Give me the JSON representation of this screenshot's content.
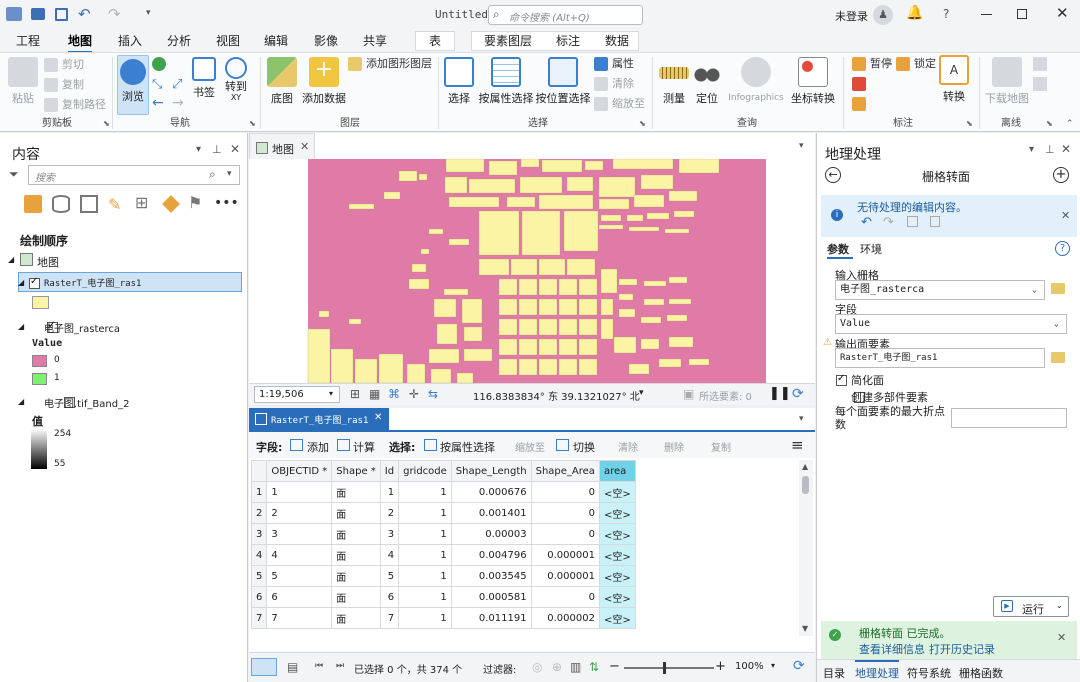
{
  "app": {
    "document_title": "Untitled",
    "command_search_placeholder": "命令搜索 (Alt+Q)",
    "user": "未登录",
    "help": "?"
  },
  "ribbon_tabs": [
    "工程",
    "地图",
    "插入",
    "分析",
    "视图",
    "编辑",
    "影像",
    "共享",
    "表",
    "要素图层",
    "标注",
    "数据"
  ],
  "ribbon": {
    "clipboard": {
      "paste": "粘贴",
      "cut": "剪切",
      "copy": "复制",
      "copy_path": "复制路径",
      "group": "剪贴板"
    },
    "navigate": {
      "explore": "浏览",
      "bookmarks": "书签",
      "goto": "转到\nXY",
      "group": "导航"
    },
    "layer": {
      "basemap": "底图",
      "add_data": "添加数据",
      "add_graphics": "添加图形图层",
      "group": "图层"
    },
    "selection": {
      "select": "选择",
      "by_attr": "按属性选择",
      "by_loc": "按位置选择",
      "attributes": "属性",
      "clear": "清除",
      "zoom_to": "缩放至",
      "group": "选择"
    },
    "inquiry": {
      "measure": "测量",
      "locate": "定位",
      "infographics": "Infographics",
      "convert_coords": "坐标转换",
      "group": "查询"
    },
    "labeling": {
      "pause": "暂停",
      "lock": "锁定",
      "convert": "转换",
      "group": "标注"
    },
    "offline": {
      "download_map": "下载地图",
      "group": "离线"
    }
  },
  "contents": {
    "title": "内容",
    "search_placeholder": "搜索",
    "drawing_order": "绘制顺序",
    "map_node": "地图",
    "layer1": "RasterT_电子图_ras1",
    "layer2": "电子图_rasterca",
    "layer2_value_label": "Value",
    "layer2_v0": "0",
    "layer2_v1": "1",
    "layer3": "电子图.tif_Band_2",
    "layer3_value_label": "值",
    "layer3_max": "254",
    "layer3_min": "55"
  },
  "map_view": {
    "tab": "地图",
    "scale": "1:19,506",
    "coords": "116.8383834° 东  39.1321027° 北",
    "selected_features": "所选要素: 0"
  },
  "attribute_table": {
    "tab": "RasterT_电子图_ras1",
    "toolbar": {
      "field_label": "字段:",
      "add": "添加",
      "calculate": "计算",
      "selection_label": "选择:",
      "select_by_attr": "按属性选择",
      "zoom_to": "缩放至",
      "switch": "切换",
      "clear": "清除",
      "delete": "删除",
      "copy": "复制"
    },
    "columns": [
      "OBJECTID *",
      "Shape *",
      "Id",
      "gridcode",
      "Shape_Length",
      "Shape_Area",
      "area"
    ],
    "rows": [
      {
        "n": "1",
        "oid": "1",
        "shape": "面",
        "id": "1",
        "gridcode": "1",
        "len": "0.000676",
        "area_s": "0",
        "area": "<空>"
      },
      {
        "n": "2",
        "oid": "2",
        "shape": "面",
        "id": "2",
        "gridcode": "1",
        "len": "0.001401",
        "area_s": "0",
        "area": "<空>"
      },
      {
        "n": "3",
        "oid": "3",
        "shape": "面",
        "id": "3",
        "gridcode": "1",
        "len": "0.00003",
        "area_s": "0",
        "area": "<空>"
      },
      {
        "n": "4",
        "oid": "4",
        "shape": "面",
        "id": "4",
        "gridcode": "1",
        "len": "0.004796",
        "area_s": "0.000001",
        "area": "<空>"
      },
      {
        "n": "5",
        "oid": "5",
        "shape": "面",
        "id": "5",
        "gridcode": "1",
        "len": "0.003545",
        "area_s": "0.000001",
        "area": "<空>"
      },
      {
        "n": "6",
        "oid": "6",
        "shape": "面",
        "id": "6",
        "gridcode": "1",
        "len": "0.000581",
        "area_s": "0",
        "area": "<空>"
      },
      {
        "n": "7",
        "oid": "7",
        "shape": "面",
        "id": "7",
        "gridcode": "1",
        "len": "0.011191",
        "area_s": "0.000002",
        "area": "<空>"
      }
    ],
    "status": "已选择 0 个，共 374 个",
    "filter_label": "过滤器:",
    "zoom": "100%"
  },
  "geoprocessing": {
    "title": "地理处理",
    "tool_title": "栅格转面",
    "info_msg": "无待处理的编辑内容。",
    "tab_params": "参数",
    "tab_env": "环境",
    "input_raster_label": "输入栅格",
    "input_raster": "电子图_rasterca",
    "field_label": "字段",
    "field": "Value",
    "output_label": "输出面要素",
    "output": "RasterT_电子图_ras1",
    "simplify": "简化面",
    "multipart": "创建多部件要素",
    "max_vertices": "每个面要素的最大折点数",
    "run": "运行",
    "done_msg": "栅格转面 已完成。",
    "view_details": "查看详细信息",
    "open_history": "打开历史记录"
  },
  "bottom_tabs": [
    "目录",
    "地理处理",
    "符号系统",
    "栅格函数"
  ],
  "colors": {
    "raster_pink": "#e07aa7",
    "polygon_yellow": "#fbf4a5",
    "accent": "#2a6ebb",
    "legend_green": "#7df070"
  }
}
